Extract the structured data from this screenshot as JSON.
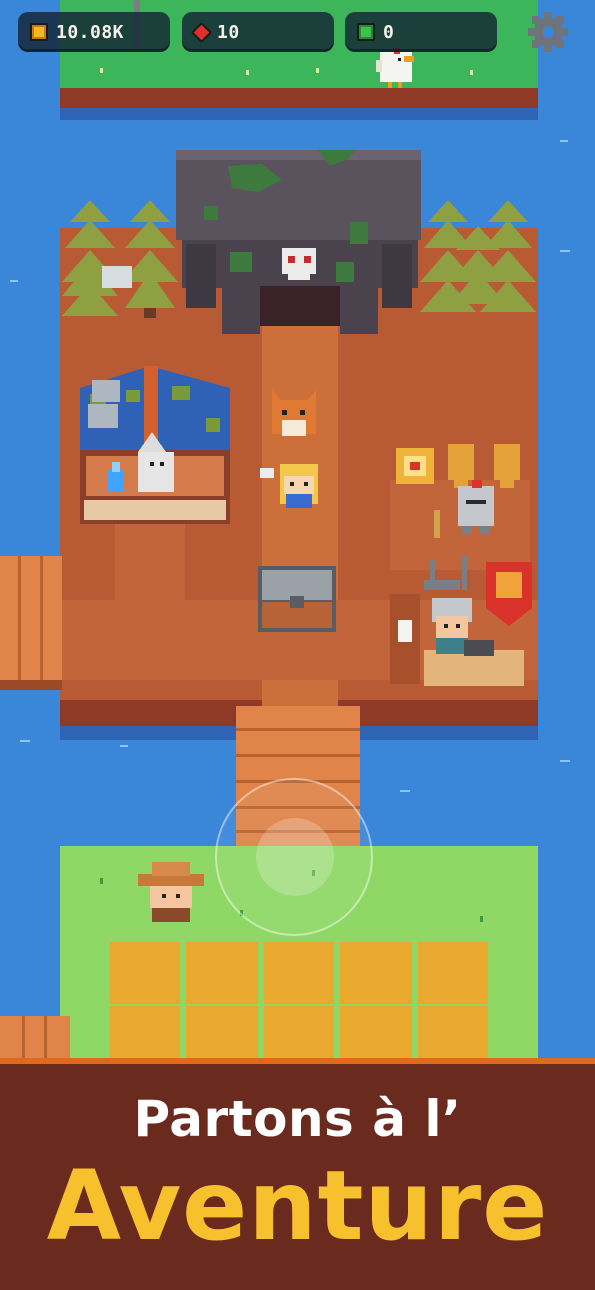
{
  "hud": {
    "gold": {
      "icon": "gold-coin-icon",
      "value": "10.08K",
      "color": "#f3b81f"
    },
    "ruby": {
      "icon": "ruby-gem-icon",
      "value": "10",
      "color": "#d8322b"
    },
    "emerald": {
      "icon": "emerald-gem-icon",
      "value": "0",
      "color": "#3fc14e"
    },
    "settings": {
      "icon": "gear-icon"
    }
  },
  "banner": {
    "line1": "Partons à l’",
    "line2": "Aventure",
    "line1_color": "#ffffff",
    "line2_color": "#f6c12d",
    "background": "#6a2a1e"
  },
  "colors": {
    "water": "#3a86d8",
    "grass": "#8fd865",
    "dirt": "#b85a34",
    "path": "#cc6f3a",
    "wood": "#e0844a"
  }
}
